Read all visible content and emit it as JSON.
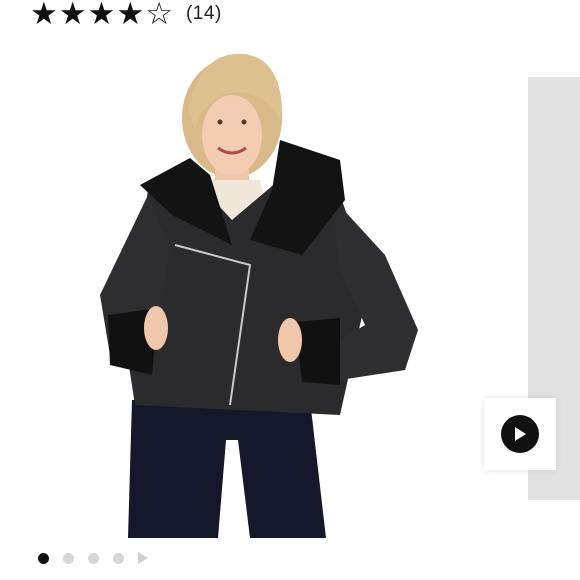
{
  "rating": {
    "stars_filled": 4,
    "stars_total": 5,
    "review_count_label": "(14)"
  },
  "gallery": {
    "image_count": 5,
    "active_index": 0,
    "has_video": true
  },
  "colors": {
    "text": "#111111",
    "dot_inactive": "#d6d6d6",
    "side_panel": "#e2e2e2"
  }
}
